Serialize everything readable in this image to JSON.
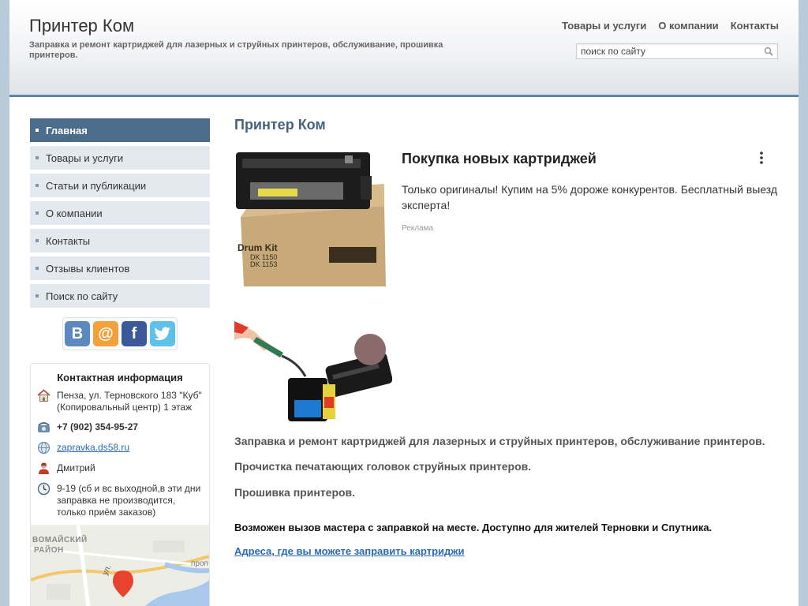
{
  "header": {
    "site_title": "Принтер Ком",
    "site_description": "Заправка и ремонт картриджей для лазерных и струйных принтеров, обслуживание, прошивка принтеров.",
    "nav": [
      "Товары и услуги",
      "О компании",
      "Контакты"
    ],
    "search": {
      "value": "поиск по сайту"
    }
  },
  "sidebar": {
    "menu": [
      {
        "label": "Главная",
        "active": true
      },
      {
        "label": "Товары и услуги",
        "active": false
      },
      {
        "label": "Статьи и публикации",
        "active": false
      },
      {
        "label": "О компании",
        "active": false
      },
      {
        "label": "Контакты",
        "active": false
      },
      {
        "label": "Отзывы клиентов",
        "active": false
      },
      {
        "label": "Поиск по сайту",
        "active": false
      }
    ],
    "social": [
      {
        "icon": "vk-icon",
        "glyph": "В",
        "color": "#5b88bd"
      },
      {
        "icon": "mailru-icon",
        "glyph": "@",
        "color": "#f5a13b"
      },
      {
        "icon": "facebook-icon",
        "glyph": "f",
        "color": "#3b5998"
      },
      {
        "icon": "twitter-icon",
        "glyph": "",
        "color": "#5ec1e8"
      }
    ],
    "contacts": {
      "title": "Контактная информация",
      "address": "Пенза, ул. Терновского 183 \"Куб\" (Копировальный центр) 1 этаж",
      "phone": "+7 (902) 354-95-27",
      "site": "zapravka.ds58.ru",
      "person": "Дмитрий",
      "hours": "9-19 (сб и вс выходной,в эти дни заправка не производится, только приём заказов)",
      "map_labels": [
        "ВОМАЙСКИЙ",
        "РАЙОН",
        "ул.",
        "проп"
      ]
    }
  },
  "main": {
    "title": "Принтер Ком",
    "ad": {
      "title": "Покупка новых картриджей",
      "text": "Только оригиналы! Купим на 5% дороже конкурентов. Бесплатный выезд эксперта!",
      "label": "Реклама",
      "box_lines": [
        "Drum Kit",
        "DK 1150",
        "DK 1153"
      ]
    },
    "paragraphs": [
      "Заправка и ремонт картриджей для лазерных и струйных принтеров, обслуживание принтеров.",
      "Прочистка печатающих головок струйных принтеров.",
      "Прошивка принтеров."
    ],
    "notice": "Возможен вызов мастера с заправкой на месте. Доступно для жителей Терновки и Спутника.",
    "link": "Адреса, где вы можете заправить картриджи"
  },
  "colors": {
    "accent": "#4c6c8c",
    "header_border": "#5a89ad",
    "menu_bg": "#e4e9ef",
    "title": "#45637e",
    "link": "#2a6ab5"
  }
}
